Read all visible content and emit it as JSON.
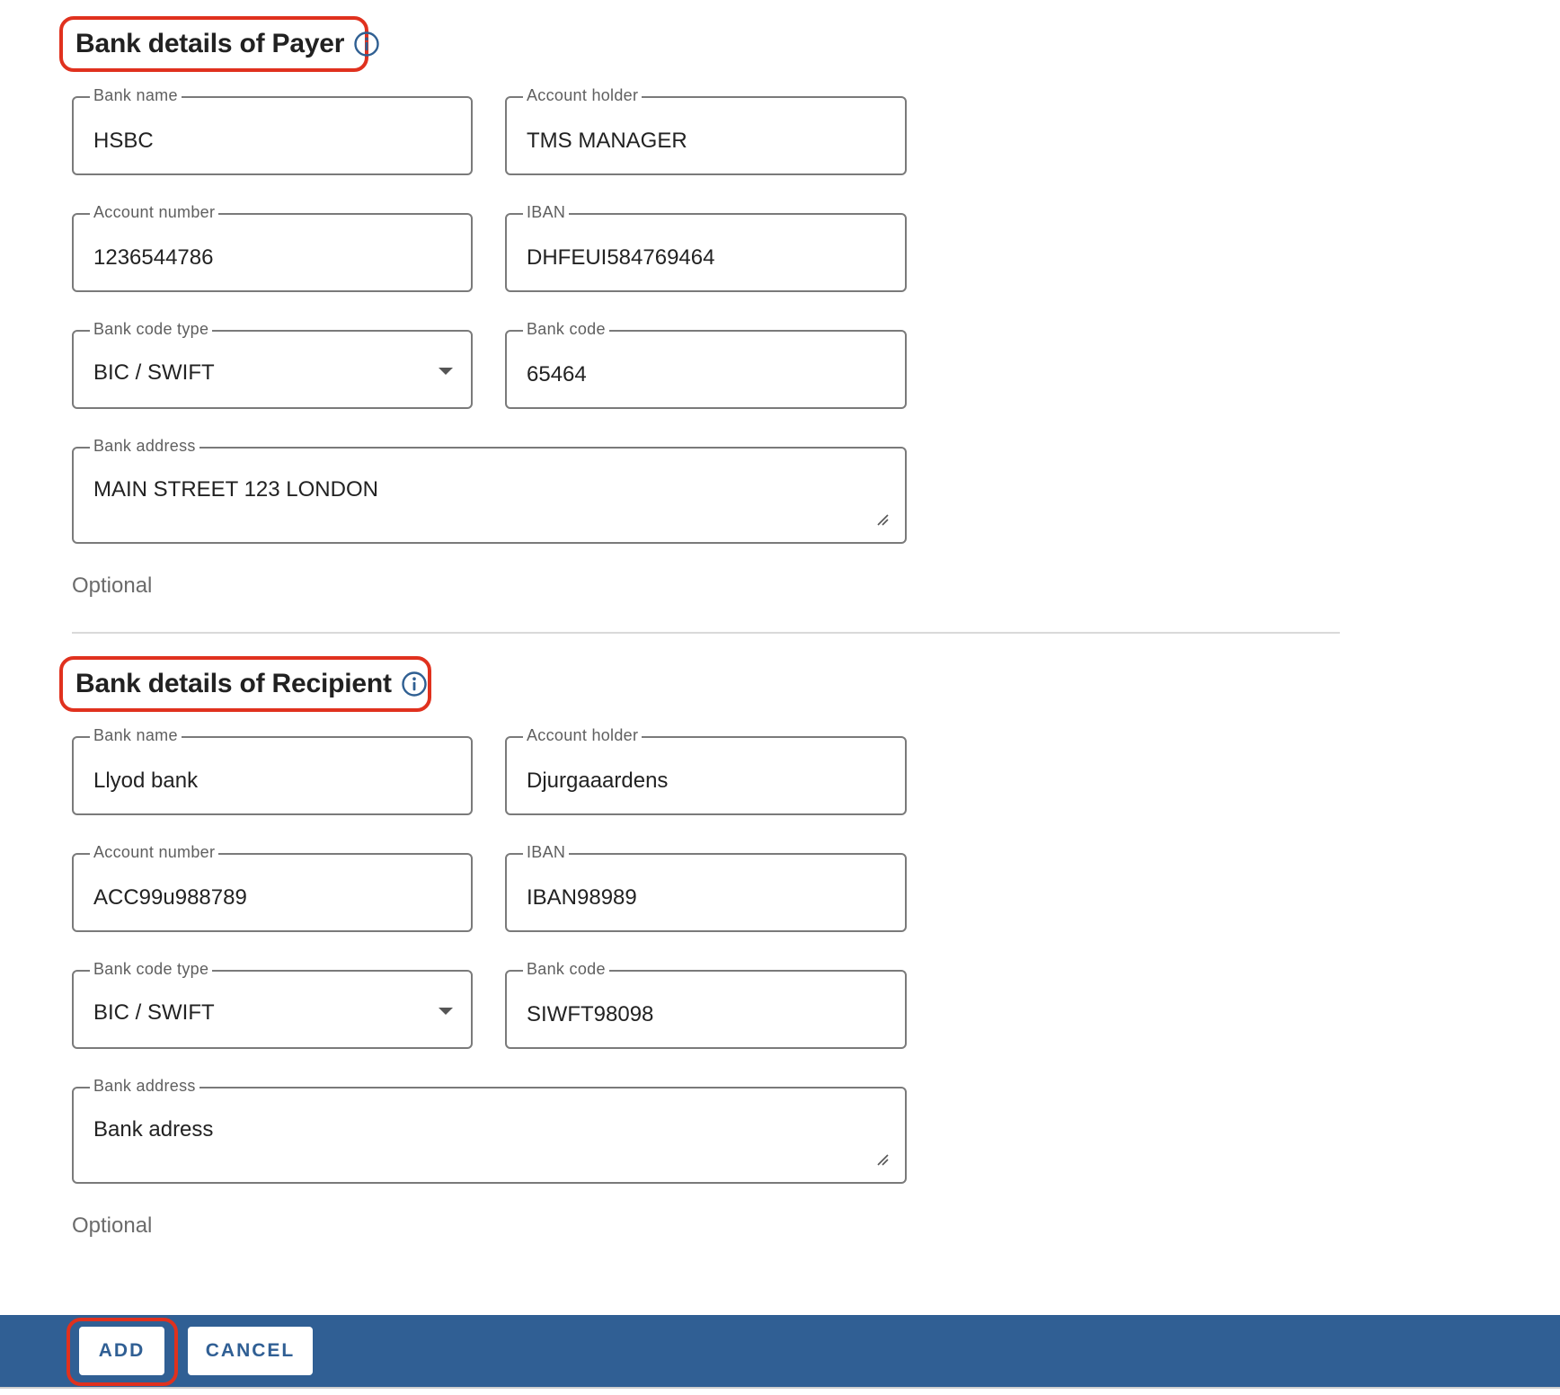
{
  "payer": {
    "heading": "Bank details of Payer",
    "bank_name": {
      "label": "Bank name",
      "value": "HSBC"
    },
    "account_holder": {
      "label": "Account holder",
      "value": "TMS MANAGER"
    },
    "account_number": {
      "label": "Account number",
      "value": "1236544786"
    },
    "iban": {
      "label": "IBAN",
      "value": "DHFEUI584769464"
    },
    "bank_code_type": {
      "label": "Bank code type",
      "value": "BIC / SWIFT"
    },
    "bank_code": {
      "label": "Bank code",
      "value": "65464"
    },
    "bank_address": {
      "label": "Bank address",
      "value": "MAIN STREET 123 LONDON"
    },
    "optional_text": "Optional"
  },
  "recipient": {
    "heading": "Bank details of Recipient",
    "bank_name": {
      "label": "Bank name",
      "value": "Llyod bank"
    },
    "account_holder": {
      "label": "Account holder",
      "value": "Djurgaaardens"
    },
    "account_number": {
      "label": "Account number",
      "value": "ACC99u988789"
    },
    "iban": {
      "label": "IBAN",
      "value": "IBAN98989"
    },
    "bank_code_type": {
      "label": "Bank code type",
      "value": "BIC / SWIFT"
    },
    "bank_code": {
      "label": "Bank code",
      "value": "SIWFT98098"
    },
    "bank_address": {
      "label": "Bank address",
      "value": "Bank adress"
    },
    "optional_text": "Optional"
  },
  "footer": {
    "add_label": "ADD",
    "cancel_label": "CANCEL"
  },
  "colors": {
    "highlight": "#e0311e",
    "footer_bar": "#305f94",
    "info_icon": "#2f5f92"
  },
  "icons": {
    "info": "info-circle-icon",
    "dropdown": "caret-down-icon",
    "resize": "resize-handle-icon"
  }
}
